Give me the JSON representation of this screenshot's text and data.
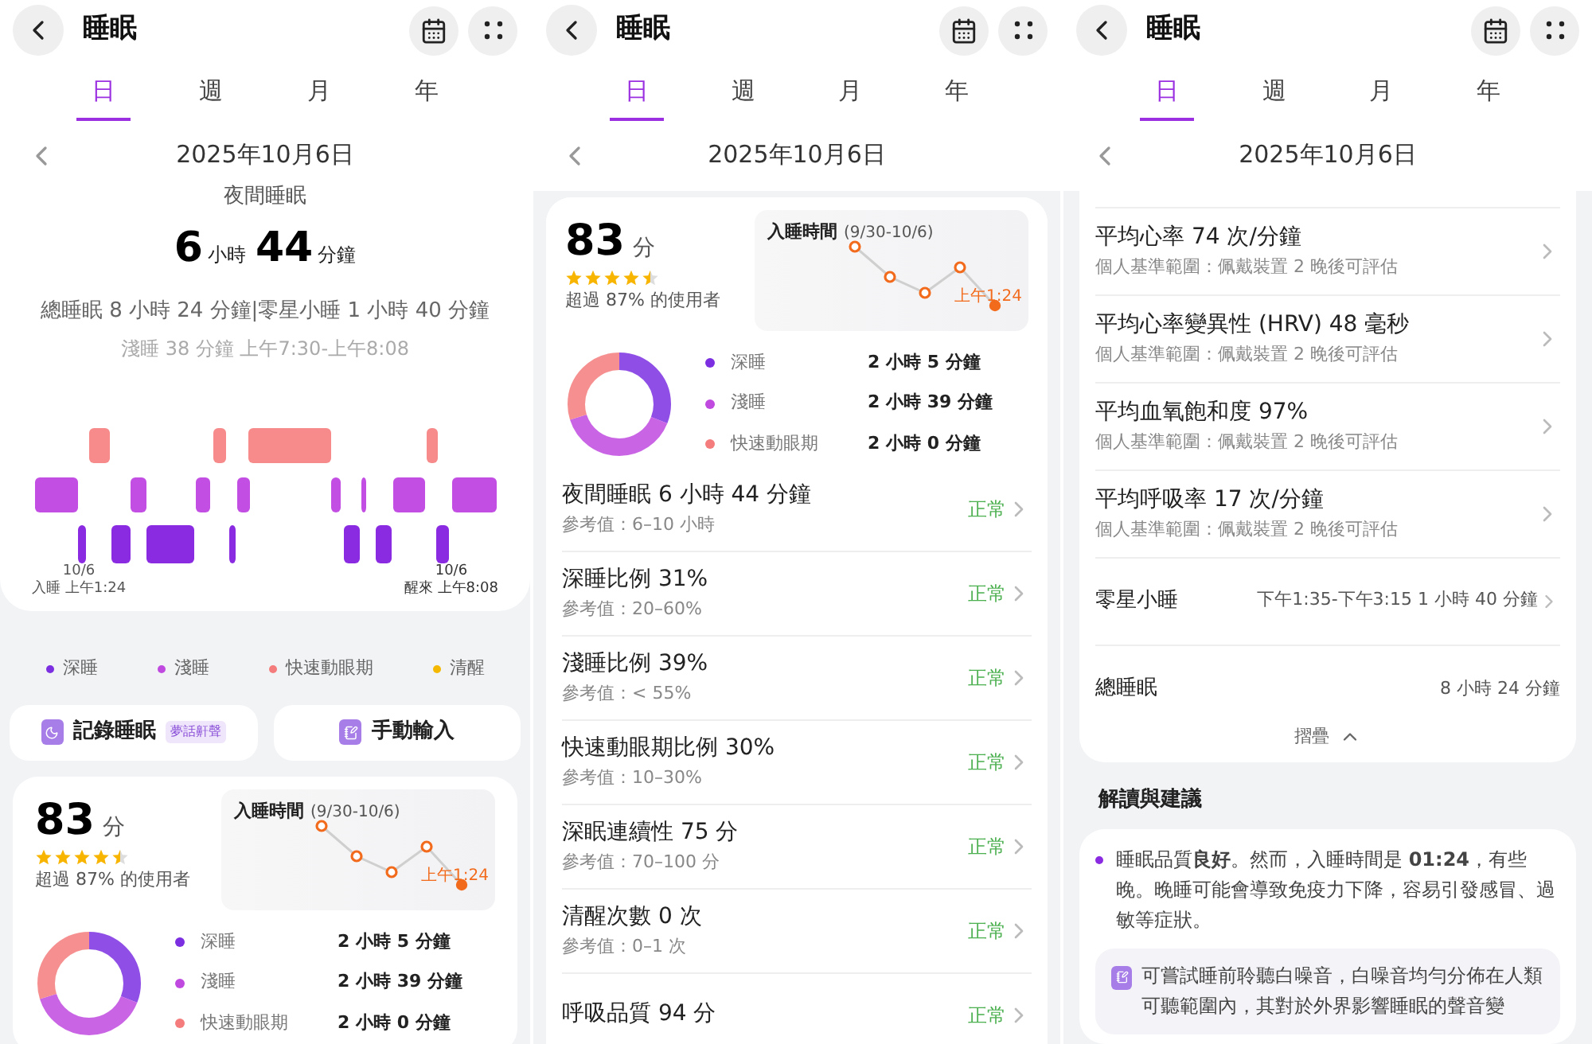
{
  "screens": [
    {
      "title": "睡眠",
      "tabs": [
        {
          "label": "日",
          "selected": true
        },
        {
          "label": "週",
          "selected": false
        },
        {
          "label": "月",
          "selected": false
        },
        {
          "label": "年",
          "selected": false
        }
      ],
      "date": "2025年10月6日",
      "night": {
        "label": "夜間睡眠",
        "hours": "6",
        "hours_unit": "小時",
        "minutes": "44",
        "minutes_unit": "分鐘",
        "summary": "總睡眠 8 小時 24 分鐘|零星小睡 1 小時 40 分鐘",
        "segment": "淺睡 38 分鐘 上午7:30-上午8:08",
        "start": {
          "date": "10/6",
          "text": "入睡 上午1:24"
        },
        "end": {
          "date": "10/6",
          "text": "醒來 上午8:08"
        }
      },
      "legend": [
        {
          "label": "深睡",
          "color": "#7b2fe0"
        },
        {
          "label": "淺睡",
          "color": "#c04ae0"
        },
        {
          "label": "快速動眼期",
          "color": "#f47c7c"
        },
        {
          "label": "清醒",
          "color": "#f5b800"
        }
      ],
      "actions": [
        {
          "kind": "record",
          "label": "記錄睡眠",
          "badge": "夢話鼾聲"
        },
        {
          "kind": "manual",
          "label": "手動輸入"
        }
      ],
      "score": {
        "value": "83",
        "unit": "分",
        "stars": 4.5,
        "percentile": "超過 87% 的使用者",
        "trend": {
          "title": "入睡時間",
          "range": "(9/30-10/6)",
          "label": "上午1:24"
        },
        "breakdown": [
          {
            "label": "深睡",
            "value": "2 小時 5 分鐘",
            "color": "#7b2fe0"
          },
          {
            "label": "淺睡",
            "value": "2 小時 39 分鐘",
            "color": "#c04ae0"
          },
          {
            "label": "快速動眼期",
            "value": "2 小時 0 分鐘",
            "color": "#f47c7c"
          }
        ]
      }
    },
    {
      "title": "睡眠",
      "tabs": [
        {
          "label": "日",
          "selected": true
        },
        {
          "label": "週",
          "selected": false
        },
        {
          "label": "月",
          "selected": false
        },
        {
          "label": "年",
          "selected": false
        }
      ],
      "date": "2025年10月6日",
      "score": {
        "value": "83",
        "unit": "分",
        "stars": 4.5,
        "percentile": "超過 87% 的使用者",
        "trend": {
          "title": "入睡時間",
          "range": "(9/30-10/6)",
          "label": "上午1:24"
        },
        "breakdown": [
          {
            "label": "深睡",
            "value": "2 小時 5 分鐘",
            "color": "#7b2fe0"
          },
          {
            "label": "淺睡",
            "value": "2 小時 39 分鐘",
            "color": "#c04ae0"
          },
          {
            "label": "快速動眼期",
            "value": "2 小時 0 分鐘",
            "color": "#f47c7c"
          }
        ]
      },
      "metrics": [
        {
          "title": "夜間睡眠 6 小時 44 分鐘",
          "reference": "參考值：6–10 小時",
          "status": "正常"
        },
        {
          "title": "深睡比例 31%",
          "reference": "參考值：20–60%",
          "status": "正常"
        },
        {
          "title": "淺睡比例 39%",
          "reference": "參考值：< 55%",
          "status": "正常"
        },
        {
          "title": "快速動眼期比例 30%",
          "reference": "參考值：10–30%",
          "status": "正常"
        },
        {
          "title": "深眠連續性 75 分",
          "reference": "參考值：70–100 分",
          "status": "正常"
        },
        {
          "title": "清醒次數 0 次",
          "reference": "參考值：0–1 次",
          "status": "正常"
        },
        {
          "title": "呼吸品質 94 分",
          "status": "正常"
        }
      ]
    },
    {
      "title": "睡眠",
      "tabs": [
        {
          "label": "日",
          "selected": true
        },
        {
          "label": "週",
          "selected": false
        },
        {
          "label": "月",
          "selected": false
        },
        {
          "label": "年",
          "selected": false
        }
      ],
      "date": "2025年10月6日",
      "vitals": [
        {
          "title": "平均心率 74 次/分鐘",
          "note": "個人基準範圍：佩戴裝置 2 晚後可評估"
        },
        {
          "title": "平均心率變異性 (HRV) 48 毫秒",
          "note": "個人基準範圍：佩戴裝置 2 晚後可評估"
        },
        {
          "title": "平均血氧飽和度 97%",
          "note": "個人基準範圍：佩戴裝置 2 晚後可評估"
        },
        {
          "title": "平均呼吸率 17 次/分鐘",
          "note": "個人基準範圍：佩戴裝置 2 晚後可評估"
        }
      ],
      "nap": {
        "label": "零星小睡",
        "value": "下午1:35-下午3:15 1 小時 40 分鐘"
      },
      "total": {
        "label": "總睡眠",
        "value": "8 小時 24 分鐘"
      },
      "collapse": "摺疊",
      "advice_title": "解讀與建議",
      "advice": "睡眠品質**良好**。然而，入睡時間是 **01:24**，有些晚。晚睡可能會導致免疫力下降，容易引發感冒、過敏等症狀。",
      "tip": "可嘗試睡前聆聽白噪音，白噪音均勻分佈在人類可聽範圍內，其對於外界影響睡眠的聲音變"
    }
  ]
}
